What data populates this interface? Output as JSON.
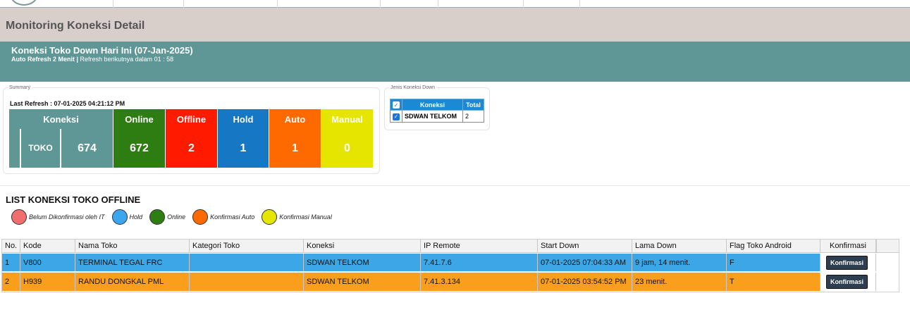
{
  "page": {
    "title": "Monitoring Koneksi Detail"
  },
  "banner": {
    "title": "Koneksi Toko Down Hari Ini (07-Jan-2025)",
    "auto_refresh": "Auto Refresh 2 Menit",
    "separator": " | ",
    "countdown": "Refresh berikutnya dalam 01 : 58"
  },
  "summary": {
    "legend": "Summary",
    "last_refresh": "Last Refresh : 07-01-2025 04:21:12 PM",
    "headers": {
      "koneksi": "Koneksi",
      "online": "Online",
      "offline": "Offline",
      "hold": "Hold",
      "auto": "Auto",
      "manual": "Manual"
    },
    "type_label": "TOKO",
    "values": {
      "koneksi": "674",
      "online": "672",
      "offline": "2",
      "hold": "1",
      "auto": "1",
      "manual": "0"
    },
    "colors": {
      "koneksi": "#5e9795",
      "online": "#2e7d12",
      "offline": "#ff1a00",
      "hold": "#1677c5",
      "auto": "#ff6a00",
      "manual": "#e5e500"
    }
  },
  "jenis": {
    "legend": "Jenis Koneksi Down",
    "col_koneksi": "Koneksi",
    "col_total": "Total",
    "rows": [
      {
        "checked": true,
        "koneksi": "SDWAN TELKOM",
        "total": "2"
      }
    ]
  },
  "list": {
    "title": "LIST KONEKSI TOKO OFFLINE",
    "legend": [
      {
        "label": "Belum Dikonfirmasi oleh IT",
        "color": "#f26d6d"
      },
      {
        "label": "Hold",
        "color": "#39a6ef"
      },
      {
        "label": "Online",
        "color": "#2e7d12"
      },
      {
        "label": "Konfirmasi Auto",
        "color": "#ff6a00"
      },
      {
        "label": "Konfirmasi Manual",
        "color": "#e5e500"
      }
    ],
    "columns": [
      "No.",
      "Kode",
      "Nama Toko",
      "Kategori Toko",
      "Koneksi",
      "IP Remote",
      "Start Down",
      "Lama Down",
      "Flag Toko Android",
      "Konfirmasi"
    ],
    "rows": [
      {
        "no": "1",
        "kode": "V800",
        "nama": "TERMINAL TEGAL FRC",
        "kategori": "",
        "koneksi": "SDWAN TELKOM",
        "ip": "7.41.7.6",
        "start": "07-01-2025 07:04:33 AM",
        "lama": "9 jam, 14 menit.",
        "flag": "F",
        "button": "Konfirmasi"
      },
      {
        "no": "2",
        "kode": "H939",
        "nama": "RANDU DONGKAL PML",
        "kategori": "",
        "koneksi": "SDWAN TELKOM",
        "ip": "7.41.3.134",
        "start": "07-01-2025 03:54:52 PM",
        "lama": "23 menit.",
        "flag": "T",
        "button": "Konfirmasi"
      }
    ]
  }
}
